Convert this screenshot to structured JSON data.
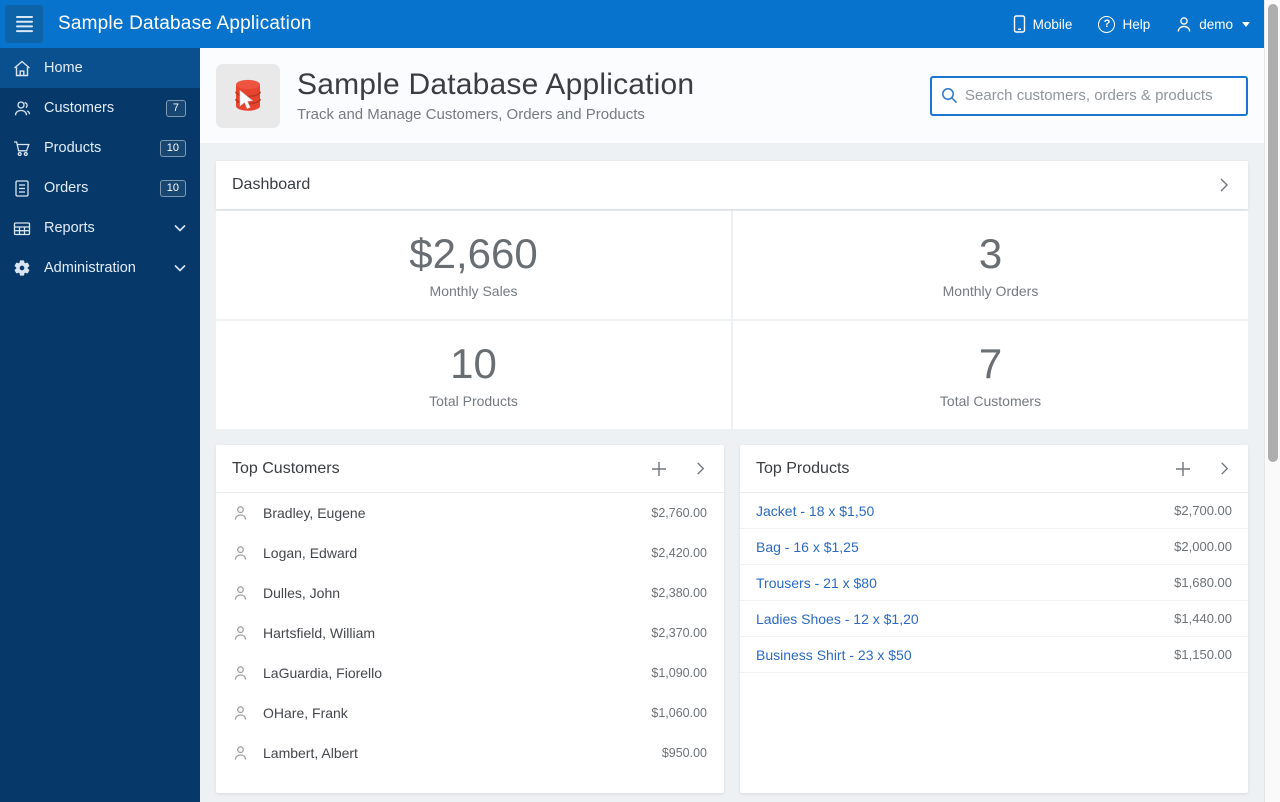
{
  "colors": {
    "appbar-bg": "#0873cc",
    "burger-bg": "#0d63a8",
    "sidebar-bg": "#063969",
    "sidebar-active-bg": "#0b508e",
    "accent": "#1b75d2",
    "link": "#2b6bc4",
    "content-bg": "#eef1f4"
  },
  "appbar": {
    "title": "Sample Database Application",
    "actions": [
      {
        "label": "Mobile",
        "icon": "mobile-icon"
      },
      {
        "label": "Help",
        "icon": "help-icon"
      },
      {
        "label": "demo",
        "icon": "user-icon"
      }
    ]
  },
  "sidebar": {
    "items": [
      {
        "label": "Home",
        "icon": "home-icon",
        "active": true
      },
      {
        "label": "Customers",
        "icon": "customers-icon",
        "badge": "7"
      },
      {
        "label": "Products",
        "icon": "cart-icon",
        "badge": "10"
      },
      {
        "label": "Orders",
        "icon": "orders-icon",
        "badge": "10"
      },
      {
        "label": "Reports",
        "icon": "reports-icon",
        "expandable": true
      },
      {
        "label": "Administration",
        "icon": "gear-icon",
        "expandable": true
      }
    ]
  },
  "page_header": {
    "title": "Sample Database Application",
    "subtitle": "Track and Manage Customers, Orders and Products",
    "search_placeholder": "Search customers, orders & products"
  },
  "dashboard": {
    "title": "Dashboard",
    "stats": [
      {
        "value": "$2,660",
        "label": "Monthly Sales"
      },
      {
        "value": "3",
        "label": "Monthly Orders"
      },
      {
        "value": "10",
        "label": "Total Products"
      },
      {
        "value": "7",
        "label": "Total Customers"
      }
    ]
  },
  "top_customers": {
    "title": "Top Customers",
    "rows": [
      {
        "name": "Bradley, Eugene",
        "amount": "$2,760.00"
      },
      {
        "name": "Logan, Edward",
        "amount": "$2,420.00"
      },
      {
        "name": "Dulles, John",
        "amount": "$2,380.00"
      },
      {
        "name": "Hartsfield, William",
        "amount": "$2,370.00"
      },
      {
        "name": "LaGuardia, Fiorello",
        "amount": "$1,090.00"
      },
      {
        "name": "OHare, Frank",
        "amount": "$1,060.00"
      },
      {
        "name": "Lambert, Albert",
        "amount": "$950.00"
      }
    ]
  },
  "top_products": {
    "title": "Top Products",
    "rows": [
      {
        "name": "Jacket - 18 x $1,50",
        "amount": "$2,700.00"
      },
      {
        "name": "Bag - 16 x $1,25",
        "amount": "$2,000.00"
      },
      {
        "name": "Trousers - 21 x $80",
        "amount": "$1,680.00"
      },
      {
        "name": "Ladies Shoes - 12 x $1,20",
        "amount": "$1,440.00"
      },
      {
        "name": "Business Shirt - 23 x $50",
        "amount": "$1,150.00"
      }
    ]
  }
}
